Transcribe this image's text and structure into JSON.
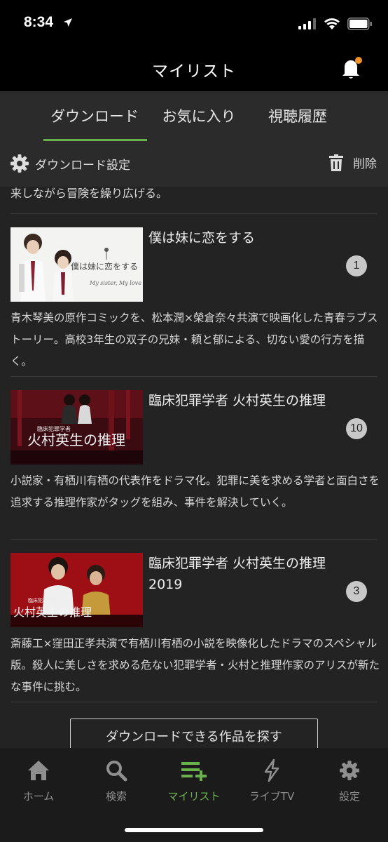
{
  "status_bar": {
    "time": "8:34"
  },
  "header": {
    "title": "マイリスト"
  },
  "tabs": [
    {
      "label": "ダウンロード",
      "active": true
    },
    {
      "label": "お気に入り",
      "active": false
    },
    {
      "label": "視聴履歴",
      "active": false
    }
  ],
  "toolbar": {
    "settings_label": "ダウンロード設定",
    "delete_label": "削除"
  },
  "list": {
    "previous_tail": "来しながら冒険を繰り広げる。",
    "items": [
      {
        "title": "僕は妹に恋をする",
        "count": "1",
        "thumb_text": "僕は妹に恋をする",
        "thumb_subtext": "My sister, My love",
        "description": "青木琴美の原作コミックを、松本潤×榮倉奈々共演で映画化した青春ラブストーリー。高校3年生の双子の兄妹・頼と郁による、切ない愛の行方を描く。"
      },
      {
        "title": "臨床犯罪学者 火村英生の推理",
        "count": "10",
        "thumb_text": "火村英生の推理",
        "thumb_subtext": "臨床犯罪学者",
        "description": "小説家・有栖川有栖の代表作をドラマ化。犯罪に美を求める学者と面白さを追求する推理作家がタッグを組み、事件を解決していく。"
      },
      {
        "title": "臨床犯罪学者 火村英生の推理 2019",
        "count": "3",
        "thumb_text": "火村英生の推理",
        "thumb_subtext": "臨床犯罪学者",
        "description": "斎藤工×窪田正孝共演で有栖川有栖の小説を映像化したドラマのスペシャル版。殺人に美しさを求める危ない犯罪学者・火村と推理作家のアリスが新たな事件に挑む。"
      }
    ],
    "find_button": "ダウンロードできる作品を探す"
  },
  "bottom_nav": [
    {
      "label": "ホーム",
      "icon": "home-icon",
      "active": false
    },
    {
      "label": "検索",
      "icon": "search-icon",
      "active": false
    },
    {
      "label": "マイリスト",
      "icon": "playlist-add-icon",
      "active": true
    },
    {
      "label": "ライブTV",
      "icon": "lightning-icon",
      "active": false
    },
    {
      "label": "設定",
      "icon": "gear-icon",
      "active": false
    }
  ],
  "colors": {
    "accent": "#6ab04c",
    "notification_dot": "#f0932b",
    "background": "#232323"
  }
}
